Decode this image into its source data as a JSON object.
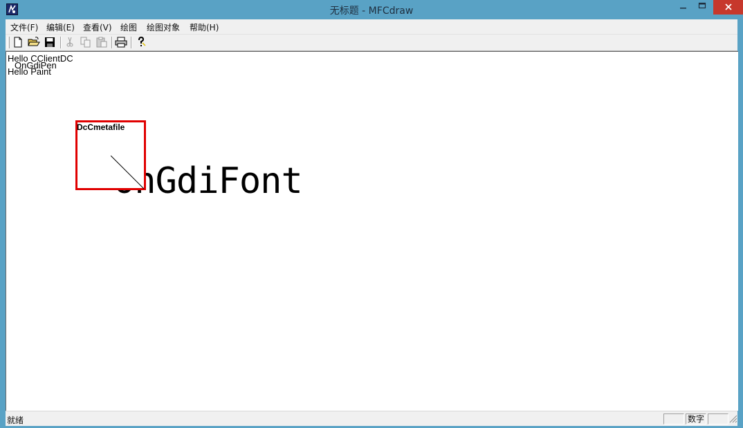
{
  "window": {
    "title": "无标题 - MFCdraw",
    "close_color": "#c7382c",
    "frame_color": "#59a2c5"
  },
  "menu": {
    "items": [
      {
        "label": "文件(F)"
      },
      {
        "label": "编辑(E)"
      },
      {
        "label": "查看(V)"
      },
      {
        "label": "绘图"
      },
      {
        "label": "绘图对象"
      },
      {
        "label": "帮助(H)"
      }
    ]
  },
  "toolbar": {
    "buttons": [
      {
        "icon": "new-file-icon",
        "enabled": true
      },
      {
        "icon": "open-folder-icon",
        "enabled": true
      },
      {
        "icon": "save-icon",
        "enabled": true
      },
      {
        "icon": "cut-icon",
        "enabled": false
      },
      {
        "icon": "copy-icon",
        "enabled": false
      },
      {
        "icon": "paste-icon",
        "enabled": false
      },
      {
        "icon": "print-icon",
        "enabled": true
      },
      {
        "icon": "help-icon",
        "enabled": true
      }
    ]
  },
  "canvas": {
    "hello_client": "Hello CClientDC",
    "ongdipen": "OnGdiPen",
    "hello_paint": "Hello Paint",
    "ongdifont": "OnGdiFont",
    "metafile_label": "DcCmetafile",
    "metafile_border_color": "#e00000"
  },
  "status": {
    "text": "就绪",
    "panes": [
      "",
      "数字",
      ""
    ]
  }
}
